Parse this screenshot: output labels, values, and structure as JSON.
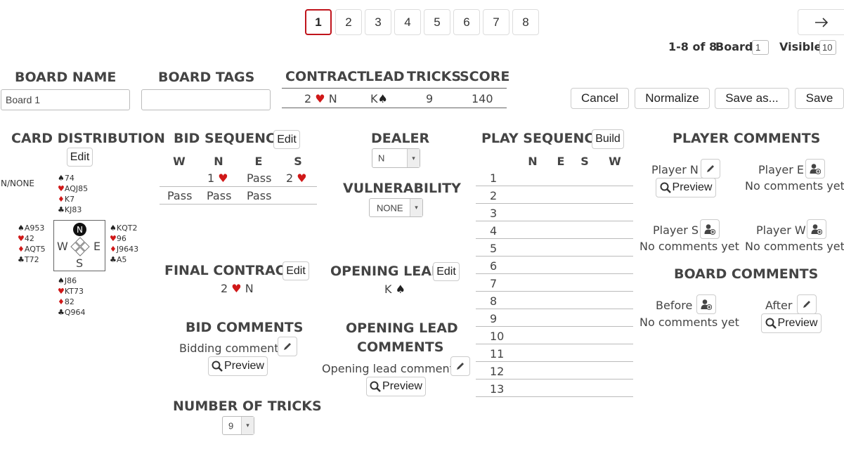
{
  "pagination": {
    "pages": [
      "1",
      "2",
      "3",
      "4",
      "5",
      "6",
      "7",
      "8"
    ],
    "next_icon": "arrow-right-icon",
    "range": "1-8 of 8",
    "board_label": "Board",
    "board_value": "1",
    "visible_label": "Visible",
    "visible_value": "10"
  },
  "board": {
    "name_header": "BOARD NAME",
    "name_value": "Board 1",
    "tags_header": "BOARD TAGS",
    "tags_value": ""
  },
  "summary": {
    "headers": [
      "CONTRACT",
      "LEAD",
      "TRICKS",
      "SCORE"
    ],
    "contract_level": "2",
    "contract_suit": "heart",
    "contract_declarer": "N",
    "lead_rank": "K",
    "lead_suit": "spade",
    "tricks": "9",
    "score": "140"
  },
  "actions": {
    "cancel": "Cancel",
    "normalize": "Normalize",
    "save_as": "Save as...",
    "save": "Save"
  },
  "card_distribution": {
    "header": "CARD DISTRIBUTION",
    "edit": "Edit",
    "dealer_vul": "N/NONE",
    "north": [
      "74",
      "AQJ85",
      "K7",
      "KJ83"
    ],
    "west": [
      "A953",
      "42",
      "AQT5",
      "T72"
    ],
    "east": [
      "KQT2",
      "96",
      "J9643",
      "A5"
    ],
    "south": [
      "J86",
      "KT73",
      "82",
      "Q964"
    ],
    "compass": {
      "n": "N",
      "w": "W",
      "e": "E",
      "s": "S"
    }
  },
  "bid_sequence": {
    "header": "BID SEQUENCE",
    "edit": "Edit",
    "columns": [
      "W",
      "N",
      "E",
      "S"
    ],
    "row1": {
      "n_level": "1",
      "e": "Pass",
      "s_level": "2"
    },
    "row2": [
      "Pass",
      "Pass",
      "Pass"
    ]
  },
  "final_contract": {
    "header": "FINAL CONTRACT",
    "edit": "Edit",
    "level": "2",
    "declarer": "N"
  },
  "bid_comments": {
    "header": "BID COMMENTS",
    "label": "Bidding comment",
    "preview": "Preview"
  },
  "number_of_tricks": {
    "header": "NUMBER OF TRICKS",
    "value": "9"
  },
  "dealer": {
    "header": "DEALER",
    "value": "N"
  },
  "vulnerability": {
    "header": "VULNERABILITY",
    "value": "NONE"
  },
  "opening_lead": {
    "header": "OPENING LEAD",
    "edit": "Edit",
    "rank": "K"
  },
  "opening_lead_comments": {
    "header1": "OPENING LEAD",
    "header2": "COMMENTS",
    "label": "Opening lead comment",
    "preview": "Preview"
  },
  "play_sequence": {
    "header": "PLAY SEQUENCE",
    "build": "Build",
    "columns": [
      "N",
      "E",
      "S",
      "W"
    ],
    "tricks": [
      "1",
      "2",
      "3",
      "4",
      "5",
      "6",
      "7",
      "8",
      "9",
      "10",
      "11",
      "12",
      "13"
    ]
  },
  "player_comments": {
    "header": "PLAYER COMMENTS",
    "player_n": "Player N",
    "player_e": "Player E",
    "player_s": "Player S",
    "player_w": "Player W",
    "no_comments": "No comments yet",
    "preview": "Preview"
  },
  "board_comments": {
    "header": "BOARD COMMENTS",
    "before": "Before",
    "after": "After",
    "no_comments": "No comments yet",
    "preview": "Preview"
  },
  "colors": {
    "accent": "#c0141c",
    "heart": "#d01818",
    "diamond": "#d01818"
  }
}
